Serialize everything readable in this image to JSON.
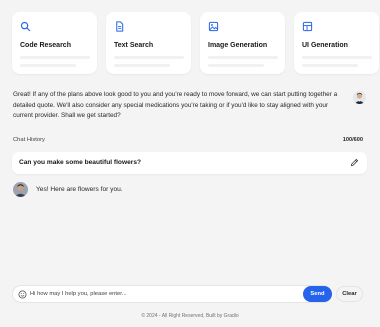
{
  "cards": [
    {
      "title": "Code Research",
      "icon": "search-icon"
    },
    {
      "title": "Text Search",
      "icon": "document-icon"
    },
    {
      "title": "Image Generation",
      "icon": "image-icon"
    },
    {
      "title": "UI Generation",
      "icon": "layout-icon"
    }
  ],
  "assistant": {
    "message": "Great! If any of the plans above look good to you and you're ready to move forward, we can start putting together a detailed quote. We'll also consider any special medications you're taking or if you'd like to stay aligned with your current provider. Shall we get started?"
  },
  "history": {
    "label": "Chat History",
    "count": "100/600"
  },
  "prompt": {
    "text": "Can you make some beautiful flowers?"
  },
  "reply": {
    "text": "Yes! Here are flowers for you."
  },
  "composer": {
    "placeholder": "Hi how may I help you, please enter...",
    "send_label": "Send",
    "clear_label": "Clear"
  },
  "footer": {
    "text": "© 2024 - All Right Reserved, Built by Gradio"
  },
  "colors": {
    "accent": "#2563eb",
    "background": "#f4f4f5"
  }
}
